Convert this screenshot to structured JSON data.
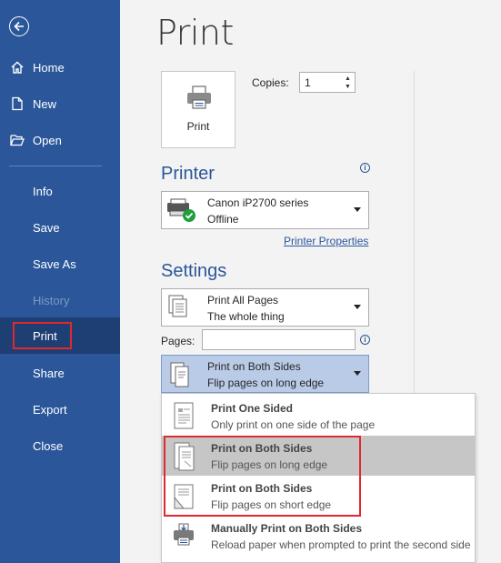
{
  "sidebar": {
    "items": [
      {
        "label": "Home",
        "icon": "home-icon"
      },
      {
        "label": "New",
        "icon": "new-document-icon"
      },
      {
        "label": "Open",
        "icon": "folder-open-icon"
      },
      {
        "label": "Info"
      },
      {
        "label": "Save"
      },
      {
        "label": "Save As"
      },
      {
        "label": "History",
        "disabled": true
      },
      {
        "label": "Print",
        "selected": true
      },
      {
        "label": "Share"
      },
      {
        "label": "Export"
      },
      {
        "label": "Close"
      }
    ]
  },
  "main": {
    "title": "Print",
    "print_button_label": "Print",
    "copies_label": "Copies:",
    "copies_value": "1",
    "printer_section_title": "Printer",
    "printer": {
      "name": "Canon iP2700 series",
      "status": "Offline"
    },
    "printer_properties_link": "Printer Properties",
    "settings_section_title": "Settings",
    "pages_setting": {
      "line1": "Print All Pages",
      "line2": "The whole thing"
    },
    "pages_label": "Pages:",
    "pages_value": "",
    "duplex_setting": {
      "line1": "Print on Both Sides",
      "line2": "Flip pages on long edge"
    }
  },
  "duplex_menu": {
    "options": [
      {
        "title": "Print One Sided",
        "subtitle": "Only print on one side of the page"
      },
      {
        "title": "Print on Both Sides",
        "subtitle": "Flip pages on long edge",
        "highlighted": true
      },
      {
        "title": "Print on Both Sides",
        "subtitle": "Flip pages on short edge"
      },
      {
        "title": "Manually Print on Both Sides",
        "subtitle": "Reload paper when prompted to print the second side"
      }
    ]
  },
  "colors": {
    "sidebar": "#2b579a",
    "sidebar_selected": "#1e3f73",
    "accent": "#2b579a",
    "highlight_box": "#e0282d"
  }
}
